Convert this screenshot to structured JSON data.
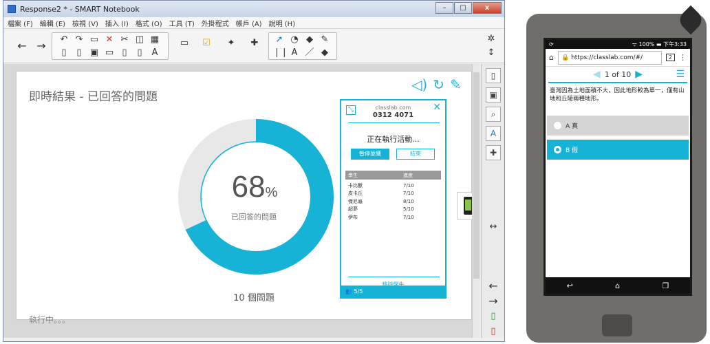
{
  "window": {
    "title": "Response2 * - SMART Notebook",
    "minimize": "–",
    "maximize": "□",
    "close": "x"
  },
  "menu": [
    "檔案 (F)",
    "編輯 (E)",
    "檢視 (V)",
    "插入 (I)",
    "格式 (O)",
    "工具 (T)",
    "外掛程式",
    "帳戶 (A)",
    "說明 (H)"
  ],
  "page": {
    "title": "即時結果 - 已回答的問題",
    "percent": "68",
    "percent_unit": "%",
    "percent_value": 68,
    "percent_label": "已回答的問題",
    "question_count": "10 個問題",
    "status": "執行中。。。"
  },
  "panel": {
    "site": "classlab.com",
    "code": "0312 4071",
    "running": "正在執行活動...",
    "pause": "暫停並獲",
    "end": "結束",
    "col_name": "學生",
    "col_progress": "進度",
    "rows": [
      {
        "name": "卡比獸",
        "progress": "7/10"
      },
      {
        "name": "皮卡丘",
        "progress": "7/10"
      },
      {
        "name": "傑尼龜",
        "progress": "8/10"
      },
      {
        "name": "超夢",
        "progress": "5/10"
      },
      {
        "name": "伊布",
        "progress": "7/10"
      }
    ],
    "remove": "移除學生",
    "footer": "5/5"
  },
  "phone": {
    "status_left": "⟳",
    "status_right": "ᯤ 100% ▬ 下午3:33",
    "url": "https://classlab.com/#/",
    "tabs": "2",
    "pager": "1 of 10",
    "question": "臺灣因為土地面積不大，因此地形較為單一，僅有山地和丘陵兩種地形。",
    "optA": "A  真",
    "optB": "B  假"
  },
  "colors": {
    "accent": "#16b3d6",
    "donut_track": "#e8e8e8"
  }
}
